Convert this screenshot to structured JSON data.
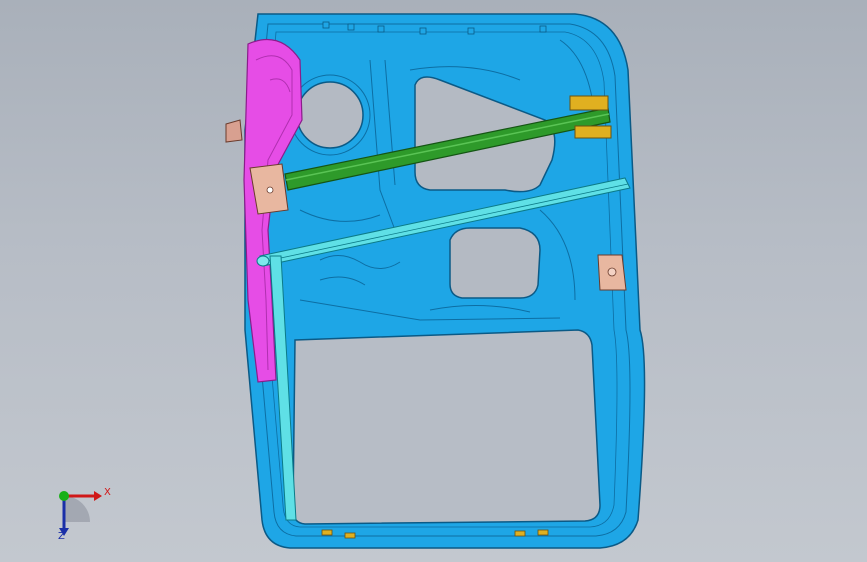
{
  "viewport": {
    "background_top": "#a9b0ba",
    "background_bottom": "#c3c8cf"
  },
  "model": {
    "parts": [
      {
        "name": "door-inner-panel",
        "color": "#1ea6e6"
      },
      {
        "name": "hinge-reinforcement",
        "color": "#e64de6"
      },
      {
        "name": "guide-rail",
        "color": "#5fe0e6"
      },
      {
        "name": "intrusion-beam",
        "color": "#2e9a2a"
      },
      {
        "name": "brackets",
        "color": "#e8b7a0"
      },
      {
        "name": "clips",
        "color": "#e0b020"
      }
    ]
  },
  "triad": {
    "x_label": "X",
    "z_label": "Z",
    "x_color": "#d01818",
    "y_color": "#18b018",
    "z_color": "#1a2fa8"
  }
}
